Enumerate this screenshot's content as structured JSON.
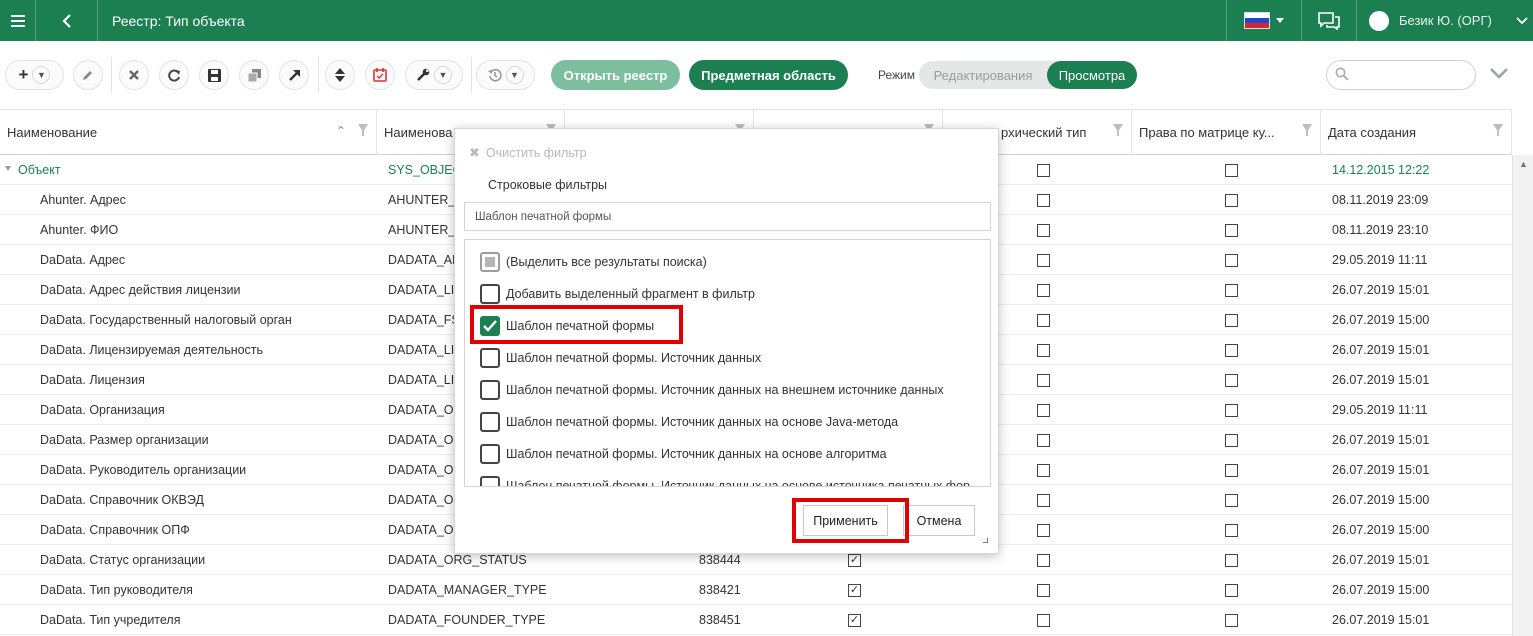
{
  "header": {
    "title": "Реестр: Тип объекта",
    "user_name": "Безик Ю. (ОРГ)",
    "flag_colors": [
      "#ffffff",
      "#1f49c8",
      "#d6262b"
    ]
  },
  "toolbar": {
    "open_registry_label": "Открыть реестр",
    "subject_area_label": "Предметная область",
    "mode_label": "Режим",
    "mode_options": [
      "Редактирования",
      "Просмотра"
    ],
    "active_mode": "Просмотра",
    "search_value": ""
  },
  "grid": {
    "columns": [
      "Наименование",
      "Наименова",
      "",
      "",
      "рхический тип",
      "Права по матрице ку...",
      "Дата создания"
    ],
    "rows": [
      {
        "name": "Объект",
        "code": "SYS_OBJEC",
        "id": "",
        "c2": "",
        "c3": "☐",
        "c4": "☐",
        "date": "14.12.2015 12:22",
        "root": true
      },
      {
        "name": "Ahunter. Адрес",
        "code": "AHUNTER_A",
        "id": "",
        "c2": "",
        "c3": "☐",
        "c4": "☐",
        "date": "08.11.2019 23:09"
      },
      {
        "name": "Ahunter. ФИО",
        "code": "AHUNTER_F",
        "id": "",
        "c2": "",
        "c3": "☐",
        "c4": "☐",
        "date": "08.11.2019 23:10"
      },
      {
        "name": "DaData. Адрес",
        "code": "DADATA_AD",
        "id": "",
        "c2": "",
        "c3": "☐",
        "c4": "☐",
        "date": "29.05.2019 11:11"
      },
      {
        "name": "DaData. Адрес действия лицензии",
        "code": "DADATA_LIC",
        "id": "",
        "c2": "",
        "c3": "☐",
        "c4": "☐",
        "date": "26.07.2019 15:01"
      },
      {
        "name": "DaData. Государственный налоговый орган",
        "code": "DADATA_FS",
        "id": "",
        "c2": "",
        "c3": "☐",
        "c4": "☐",
        "date": "26.07.2019 15:00"
      },
      {
        "name": "DaData. Лицензируемая деятельность",
        "code": "DADATA_LIC",
        "id": "",
        "c2": "",
        "c3": "☐",
        "c4": "☐",
        "date": "26.07.2019 15:01"
      },
      {
        "name": "DaData. Лицензия",
        "code": "DADATA_LIC",
        "id": "",
        "c2": "",
        "c3": "☐",
        "c4": "☐",
        "date": "26.07.2019 15:01"
      },
      {
        "name": "DaData. Организация",
        "code": "DADATA_OR",
        "id": "",
        "c2": "",
        "c3": "☐",
        "c4": "☐",
        "date": "29.05.2019 11:11"
      },
      {
        "name": "DaData. Размер организации",
        "code": "DADATA_OR",
        "id": "",
        "c2": "",
        "c3": "☐",
        "c4": "☐",
        "date": "26.07.2019 15:01"
      },
      {
        "name": "DaData. Руководитель организации",
        "code": "DADATA_OR",
        "id": "",
        "c2": "",
        "c3": "☐",
        "c4": "☐",
        "date": "26.07.2019 15:01"
      },
      {
        "name": "DaData. Справочник ОКВЭД",
        "code": "DADATA_OK",
        "id": "",
        "c2": "",
        "c3": "☐",
        "c4": "☐",
        "date": "26.07.2019 15:00"
      },
      {
        "name": "DaData. Справочник ОПФ",
        "code": "DADATA_OK",
        "id": "",
        "c2": "",
        "c3": "☐",
        "c4": "☐",
        "date": "26.07.2019 15:00"
      },
      {
        "name": "DaData. Статус организации",
        "code": "DADATA_ORG_STATUS",
        "id": "838444",
        "c2": "☑",
        "c3": "☐",
        "c4": "☐",
        "date": "26.07.2019 15:01"
      },
      {
        "name": "DaData. Тип руководителя",
        "code": "DADATA_MANAGER_TYPE",
        "id": "838421",
        "c2": "☑",
        "c3": "☐",
        "c4": "☐",
        "date": "26.07.2019 15:00"
      },
      {
        "name": "DaData. Тип учредителя",
        "code": "DADATA_FOUNDER_TYPE",
        "id": "838451",
        "c2": "☑",
        "c3": "☐",
        "c4": "☐",
        "date": "26.07.2019 15:01"
      }
    ]
  },
  "filter_popup": {
    "clear_label": "Очистить фильтр",
    "section_label": "Строковые фильтры",
    "input_value": "Шаблон печатной формы",
    "items": [
      {
        "label": "(Выделить все результаты поиска)",
        "state": "partial"
      },
      {
        "label": "Добавить выделенный фрагмент в фильтр",
        "state": "unchecked"
      },
      {
        "label": "Шаблон печатной формы",
        "state": "checked"
      },
      {
        "label": "Шаблон печатной формы. Источник данных",
        "state": "unchecked"
      },
      {
        "label": "Шаблон печатной формы. Источник данных на внешнем источнике данных",
        "state": "unchecked"
      },
      {
        "label": "Шаблон печатной формы. Источник данных на основе Java-метода",
        "state": "unchecked"
      },
      {
        "label": "Шаблон печатной формы. Источник данных на основе алгоритма",
        "state": "unchecked"
      },
      {
        "label": "Шаблон печатной формы. Источник данных на основе источника печатных фор",
        "state": "unchecked"
      }
    ],
    "apply_label": "Применить",
    "cancel_label": "Отмена"
  },
  "colors": {
    "brand": "#1b7f52",
    "brand_light": "#7cbe9d",
    "highlight": "#e00000"
  }
}
